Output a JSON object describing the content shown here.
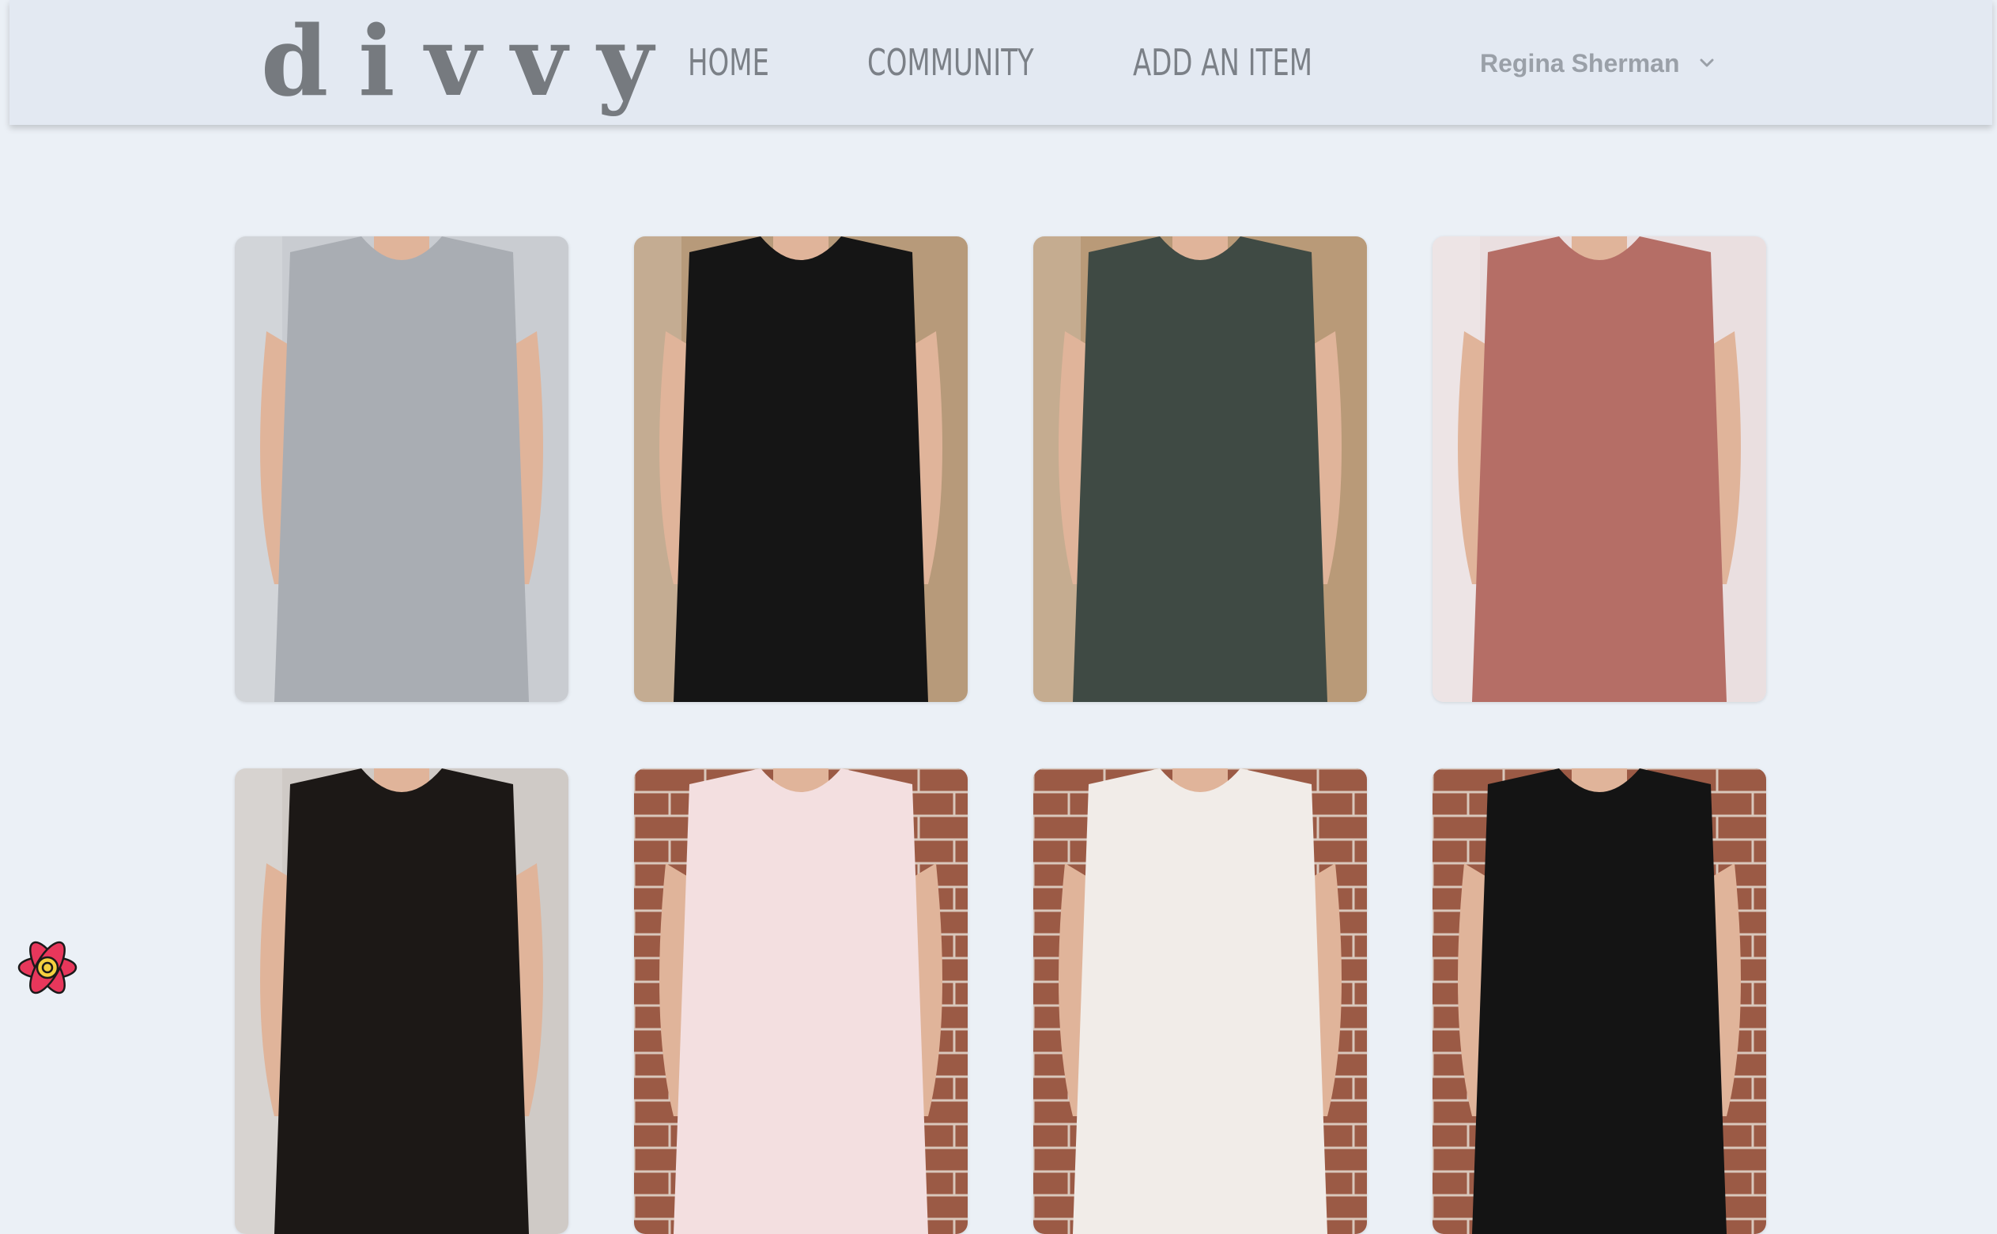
{
  "brand": {
    "logo_text": "divvy"
  },
  "nav": {
    "links": [
      {
        "label": "HOME"
      },
      {
        "label": "COMMUNITY"
      },
      {
        "label": "ADD AN ITEM"
      }
    ],
    "user": {
      "name": "Regina Sherman",
      "menu_icon": "chevron-down-icon"
    }
  },
  "items": [
    {
      "icon": "gray-tiered-dress-photo",
      "bg": "#c9ccd1",
      "garment": "#a9adb3"
    },
    {
      "icon": "black-embroidered-jumpsuit-photo",
      "bg": "#b79a7a",
      "garment": "#151515"
    },
    {
      "icon": "green-knit-cardigan-photo",
      "bg": "#b99a78",
      "garment": "#3f4a44"
    },
    {
      "icon": "pink-open-knit-sweater-photo",
      "bg": "#eadfe0",
      "garment": "#b56e66"
    },
    {
      "icon": "black-floral-top-photo",
      "bg": "#cfcac6",
      "garment": "#1c1816"
    },
    {
      "icon": "pink-polka-dot-dress-photo",
      "bg": "#9b5a45",
      "garment": "#f3dfe0"
    },
    {
      "icon": "white-flutter-sleeve-dress-photo",
      "bg": "#9b5a45",
      "garment": "#f1ece8"
    },
    {
      "icon": "black-cami-top-photo",
      "bg": "#9b5a45",
      "garment": "#141414"
    }
  ],
  "colors": {
    "page_bg": "#ebf0f6",
    "navbar_bg": "#e3e9f2",
    "nav_text": "#7b8087",
    "user_text": "#9aa0a8"
  },
  "dev_tools": {
    "icon": "react-devtools-icon"
  }
}
